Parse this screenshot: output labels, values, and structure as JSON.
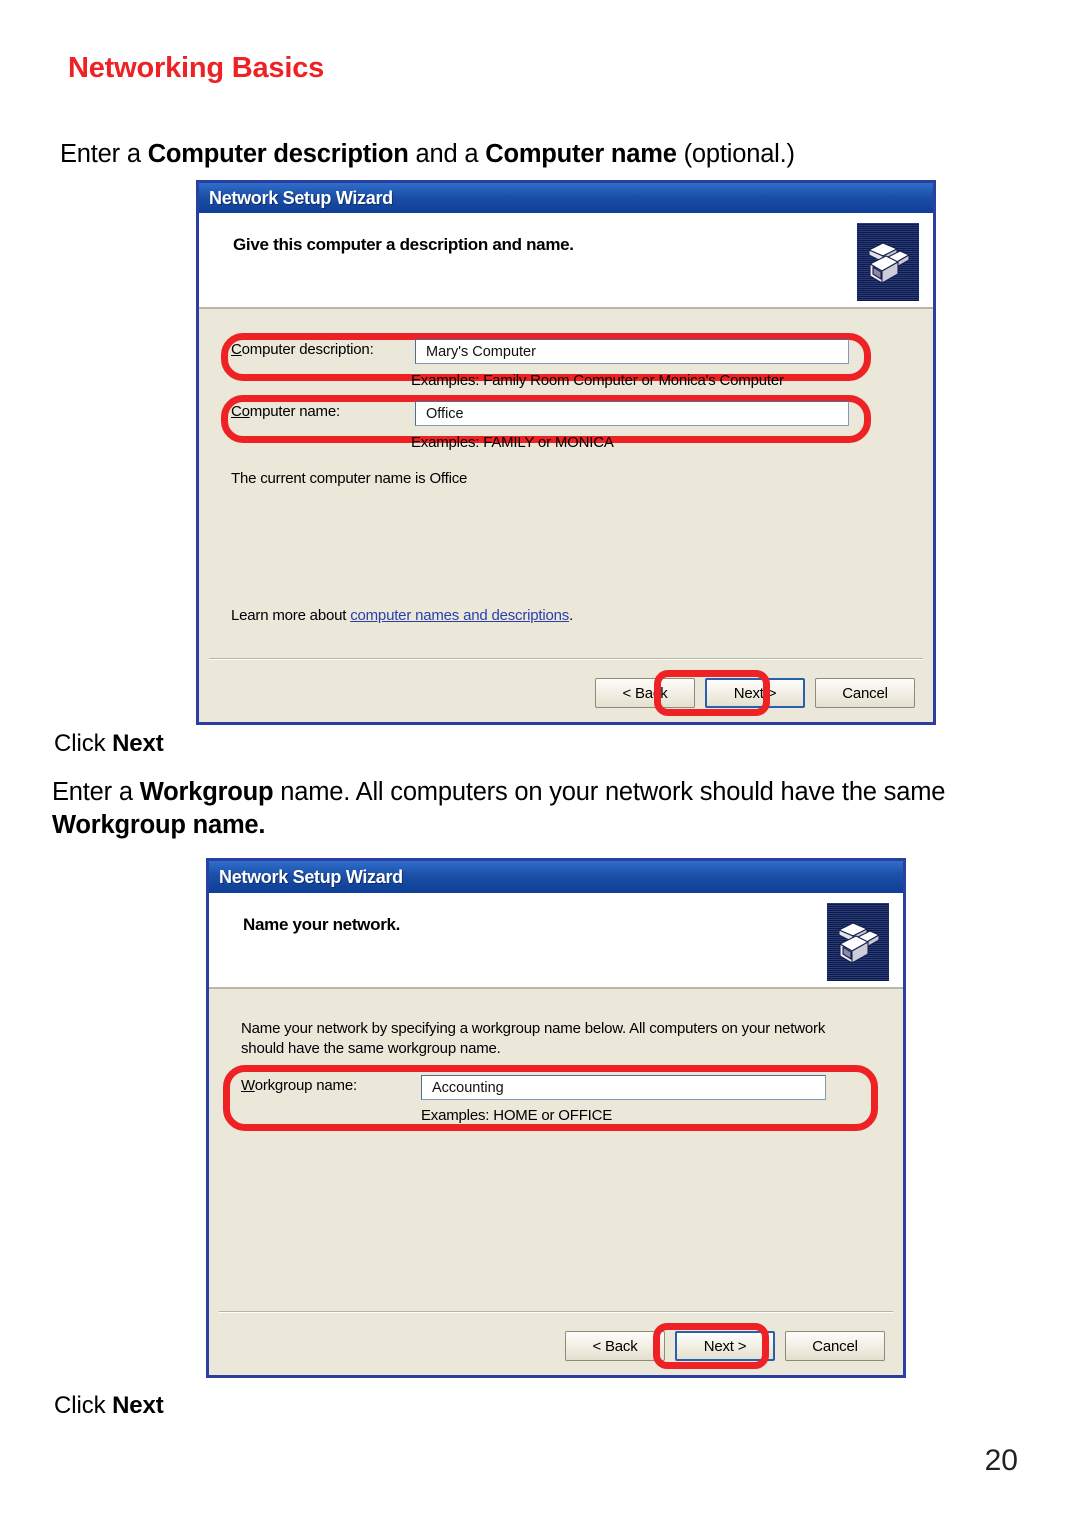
{
  "page": {
    "title": "Networking Basics",
    "number": "20",
    "title_color": "#ee2124",
    "annotation_color": "#ee2124"
  },
  "sections": [
    {
      "lead_prefix": "Enter a ",
      "lead_bold1": "Computer description",
      "lead_mid": " and a ",
      "lead_bold2": "Computer name",
      "lead_suffix": " (optional.)",
      "click_prefix": "Click ",
      "click_bold": "Next"
    },
    {
      "lead_prefix": "Enter a ",
      "lead_bold1": "Workgroup",
      "lead_mid": " name.  All computers on your network should have the same ",
      "lead_bold2": "Workgroup name.",
      "click_prefix": "Click ",
      "click_bold": "Next"
    }
  ],
  "dialog1": {
    "titlebar": "Network Setup Wizard",
    "header_title": "Give this computer a description and name.",
    "header_icon": "computers-network-icon",
    "fields": [
      {
        "label_accel": "C",
        "label_rest": "omputer description:",
        "value": "Mary's Computer",
        "hint": "Examples: Family Room Computer or Monica's Computer"
      },
      {
        "label_accel": "C",
        "label_mid": "o",
        "label_rest": "mputer name:",
        "value": "Office",
        "hint": "Examples: FAMILY or MONICA"
      }
    ],
    "current_name_text": "The current computer name is Office",
    "learn_prefix": "Learn more about ",
    "learn_link": "computer names and descriptions",
    "learn_suffix": ".",
    "buttons": {
      "back": "< Back",
      "back_accel": "B",
      "next": "Next >",
      "next_accel": "N",
      "cancel": "Cancel"
    }
  },
  "dialog2": {
    "titlebar": "Network Setup Wizard",
    "header_title": "Name your network.",
    "header_icon": "computers-network-icon",
    "body_text_line1": "Name your network by specifying a workgroup name below. All computers on your network",
    "body_text_line2": "should have the same workgroup name.",
    "field": {
      "label_accel": "W",
      "label_rest": "orkgroup name:",
      "value": "Accounting",
      "hint": "Examples: HOME or OFFICE"
    },
    "buttons": {
      "back": "< Back",
      "back_accel": "B",
      "next": "Next >",
      "next_accel": "N",
      "cancel": "Cancel"
    }
  }
}
